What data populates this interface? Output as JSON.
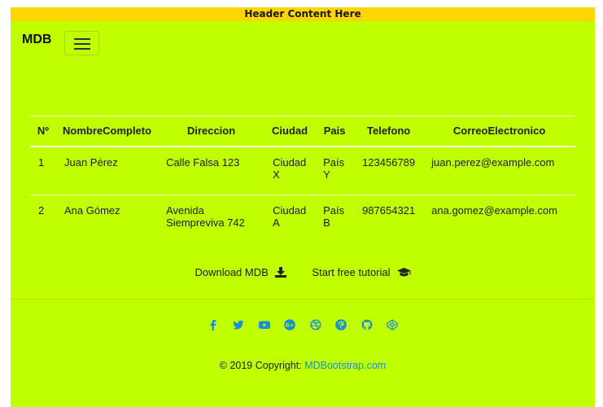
{
  "header": {
    "text": "Header Content Here"
  },
  "navbar": {
    "brand": "MDB"
  },
  "table": {
    "columns": [
      "Nº",
      "NombreCompleto",
      "Direccion",
      "Ciudad",
      "Pais",
      "Telefono",
      "CorreoElectronico"
    ],
    "rows": [
      {
        "num": "1",
        "nombre": "Juan Pérez",
        "direccion": "Calle Falsa 123",
        "ciudad": "Ciudad X",
        "pais": "País Y",
        "telefono": "123456789",
        "correo": "juan.perez@example.com"
      },
      {
        "num": "2",
        "nombre": "Ana Gómez",
        "direccion": "Avenida Siempreviva 742",
        "ciudad": "Ciudad A",
        "pais": "País B",
        "telefono": "987654321",
        "correo": "ana.gomez@example.com"
      }
    ]
  },
  "footer": {
    "download_label": "Download MDB",
    "download_icon": "download-icon",
    "tutorial_label": "Start free tutorial",
    "tutorial_icon": "graduation-cap-icon",
    "social_icons": [
      "facebook-icon",
      "twitter-icon",
      "youtube-icon",
      "google-plus-icon",
      "dribbble-icon",
      "pinterest-icon",
      "github-icon",
      "codepen-icon"
    ],
    "social_color": "#1a8fd8",
    "copyright_prefix": "© 2019 Copyright: ",
    "copyright_link": "MDBootstrap.com"
  },
  "colors": {
    "page_background": "#bfff00",
    "header_background": "#ffd600",
    "link_color": "#1a8fd8"
  }
}
